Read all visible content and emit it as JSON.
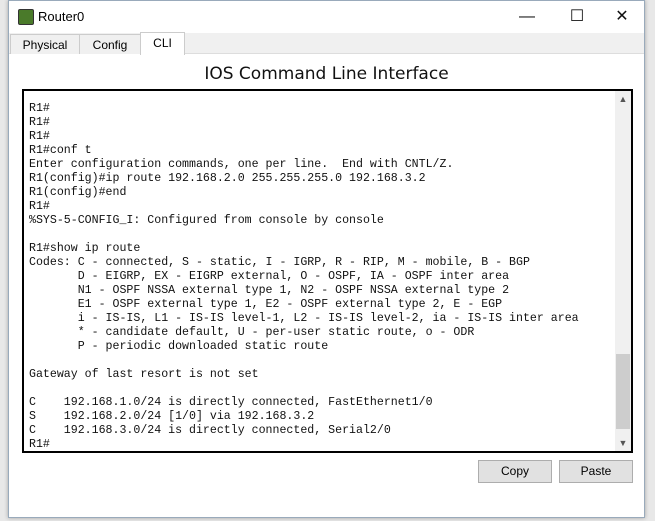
{
  "window": {
    "title": "Router0",
    "minimize": "—",
    "maximize": "☐",
    "close": "✕"
  },
  "tabs": [
    {
      "label": "Physical"
    },
    {
      "label": "Config"
    },
    {
      "label": "CLI"
    }
  ],
  "heading": "IOS Command Line Interface",
  "terminal": {
    "lines": [
      "R1#",
      "R1#",
      "R1#",
      "R1#conf t",
      "Enter configuration commands, one per line.  End with CNTL/Z.",
      "R1(config)#ip route 192.168.2.0 255.255.255.0 192.168.3.2",
      "R1(config)#end",
      "R1#",
      "%SYS-5-CONFIG_I: Configured from console by console",
      "",
      "R1#show ip route",
      "Codes: C - connected, S - static, I - IGRP, R - RIP, M - mobile, B - BGP",
      "       D - EIGRP, EX - EIGRP external, O - OSPF, IA - OSPF inter area",
      "       N1 - OSPF NSSA external type 1, N2 - OSPF NSSA external type 2",
      "       E1 - OSPF external type 1, E2 - OSPF external type 2, E - EGP",
      "       i - IS-IS, L1 - IS-IS level-1, L2 - IS-IS level-2, ia - IS-IS inter area",
      "       * - candidate default, U - per-user static route, o - ODR",
      "       P - periodic downloaded static route",
      "",
      "Gateway of last resort is not set",
      "",
      "C    192.168.1.0/24 is directly connected, FastEthernet1/0",
      "S    192.168.2.0/24 [1/0] via 192.168.3.2",
      "C    192.168.3.0/24 is directly connected, Serial2/0",
      "R1#"
    ]
  },
  "buttons": {
    "copy": "Copy",
    "paste": "Paste"
  }
}
